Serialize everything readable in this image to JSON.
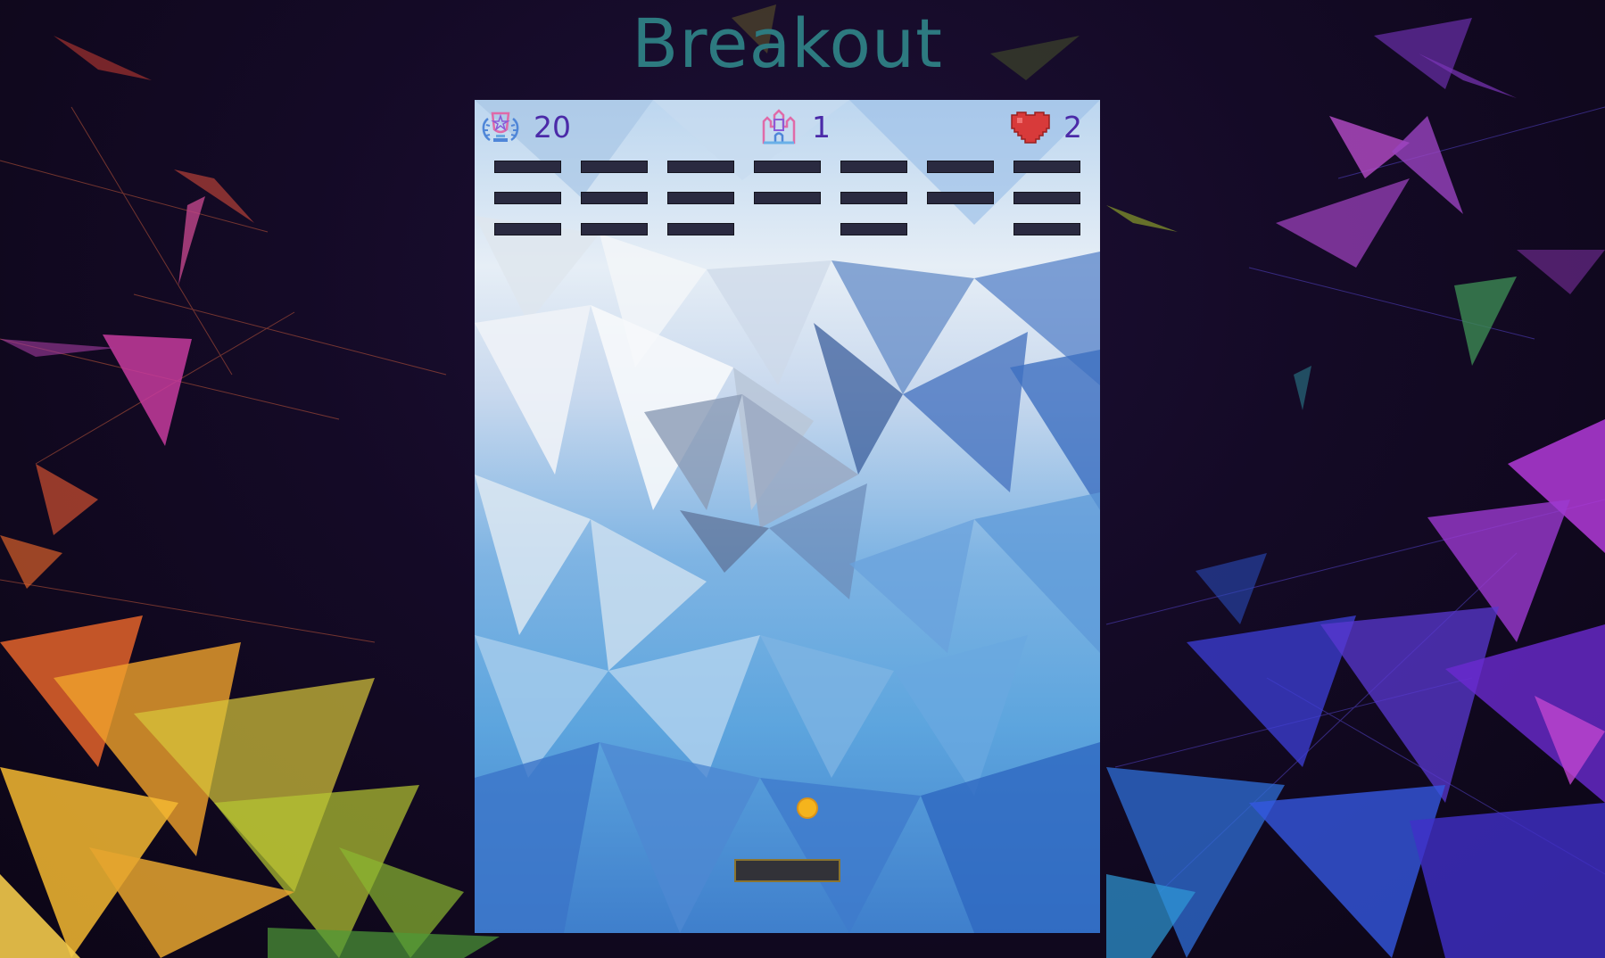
{
  "title": "Breakout",
  "hud": {
    "score": {
      "icon": "trophy-icon",
      "value": "20"
    },
    "level": {
      "icon": "castle-icon",
      "value": "1"
    },
    "lives": {
      "icon": "heart-icon",
      "value": "2"
    }
  },
  "bricks": {
    "rows": 3,
    "columns": 7,
    "layout": [
      [
        1,
        1,
        1,
        1,
        1,
        1,
        1
      ],
      [
        1,
        1,
        1,
        1,
        1,
        1,
        1
      ],
      [
        1,
        1,
        1,
        0,
        1,
        0,
        1
      ]
    ],
    "color": "#2a2a40"
  },
  "ball": {
    "color": "#f5b41c"
  },
  "paddle": {
    "color": "#323238",
    "border_color": "#8a7430"
  },
  "colors": {
    "title": "#2d7a80",
    "hud_text": "#4b2aa8",
    "background": "#140a26"
  }
}
